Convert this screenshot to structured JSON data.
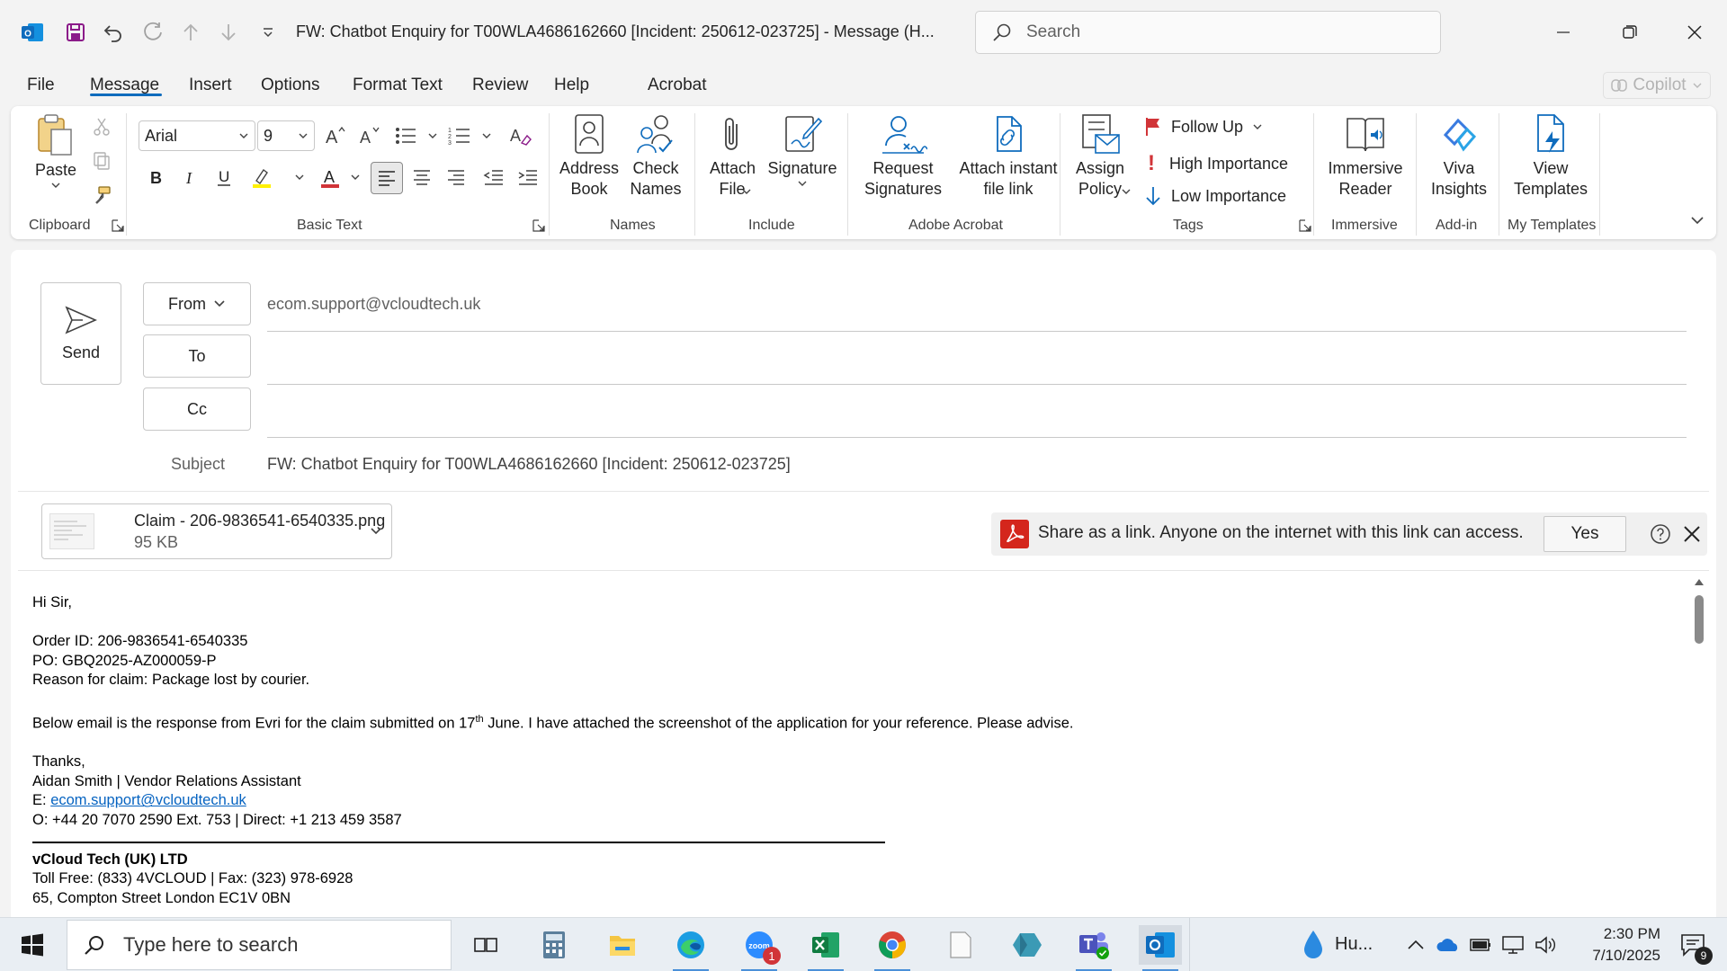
{
  "titlebar": {
    "doc_title": "FW: Chatbot Enquiry for T00WLA4686162660 [Incident: 250612-023725]  -  Message (H...",
    "search_placeholder": "Search"
  },
  "menu": {
    "tabs": [
      "File",
      "Message",
      "Insert",
      "Options",
      "Format Text",
      "Review",
      "Help",
      "Acrobat"
    ],
    "active_tab": "Message",
    "copilot_label": "Copilot"
  },
  "ribbon": {
    "clipboard": {
      "paste": "Paste",
      "group": "Clipboard"
    },
    "basic_text": {
      "font": "Arial",
      "size": "9",
      "group": "Basic Text"
    },
    "names": {
      "address_book": "Address Book",
      "check_names": "Check Names",
      "group": "Names"
    },
    "include": {
      "attach_file": "Attach File",
      "signature": "Signature",
      "group": "Include"
    },
    "acrobat": {
      "request_signatures": "Request Signatures",
      "attach_instant": "Attach instant file link",
      "group": "Adobe Acrobat"
    },
    "tags": {
      "assign_policy": "Assign Policy",
      "follow_up": "Follow Up",
      "high_importance": "High Importance",
      "low_importance": "Low Importance",
      "group": "Tags"
    },
    "immersive": {
      "reader": "Immersive Reader",
      "group": "Immersive"
    },
    "addin": {
      "viva": "Viva Insights",
      "group": "Add-in"
    },
    "templates": {
      "view": "View Templates",
      "group": "My Templates"
    }
  },
  "compose": {
    "send_label": "Send",
    "from_label": "From",
    "from_value": "ecom.support@vcloudtech.uk",
    "to_label": "To",
    "to_value": "",
    "cc_label": "Cc",
    "cc_value": "",
    "subject_label": "Subject",
    "subject_value": "FW: Chatbot Enquiry for T00WLA4686162660 [Incident: 250612-023725]"
  },
  "attachment": {
    "name": "Claim - 206-9836541-6540335.png",
    "size": "95 KB"
  },
  "share_bar": {
    "text": "Share as a link. Anyone on the internet with this link can access.",
    "yes_label": "Yes"
  },
  "message": {
    "greeting": "Hi Sir,",
    "order_id": "Order ID: 206-9836541-6540335",
    "po": "PO: GBQ2025-AZ000059-P",
    "reason": "Reason for claim: Package lost by courier.",
    "para_before": "Below email is the response from Evri for the claim submitted on 17",
    "para_sup": "th",
    "para_after": " June. I have attached the screenshot of the application for your reference.  Please advise.",
    "thanks": "Thanks,",
    "sig_name": "Aidan Smith | Vendor Relations Assistant",
    "sig_email_prefix": "E: ",
    "sig_email": "ecom.support@vcloudtech.uk",
    "sig_phone": "O:  +44 20 7070 2590 Ext. 753 | Direct: +1 213 459 3587",
    "company": "vCloud Tech (UK) LTD",
    "company_phone": "Toll Free: (833) 4VCLOUD | Fax: (323) 978-6928",
    "company_address": "65, Compton Street London EC1V 0BN"
  },
  "taskbar": {
    "search_placeholder": "Type here to search",
    "weather": "Hu...",
    "time": "2:30 PM",
    "date": "7/10/2025",
    "notification_count": "9",
    "zoom_badge": "1"
  },
  "colors": {
    "accent": "#0f6cbd",
    "outlook_blue": "#0f6cbd",
    "adobe_red": "#d4261c",
    "follow_up_flag": "#d13438"
  }
}
